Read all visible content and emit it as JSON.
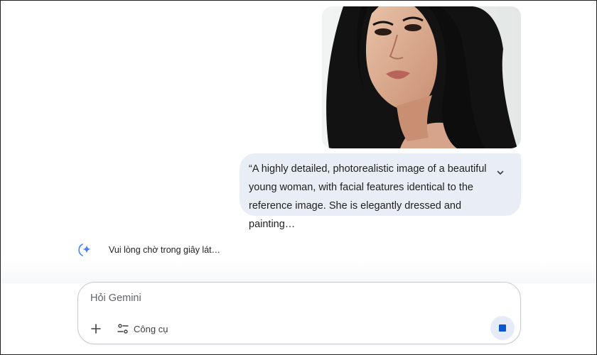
{
  "conversation": {
    "uploaded_image": {
      "alt": "reference portrait image"
    },
    "prompt": {
      "text": "“A highly detailed, photorealistic image of a beautiful\nyoung woman, with facial features identical to the\nreference image. She is elegantly dressed and painting…"
    },
    "response": {
      "status_text": "Vui lòng chờ trong giây lát…",
      "icon": "gemini-spark-icon"
    }
  },
  "composer": {
    "placeholder": "Hỏi Gemini",
    "add_icon": "plus-icon",
    "tools_icon": "tune-icon",
    "tools_label": "Công cụ",
    "stop_icon": "stop-icon"
  },
  "colors": {
    "accent": "#0b57d0",
    "bubble_bg": "#e9eef6",
    "stop_bg": "#e6ecf7"
  }
}
